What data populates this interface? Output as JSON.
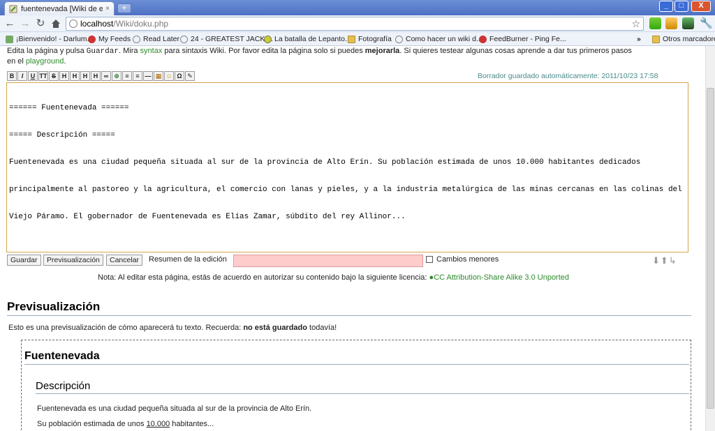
{
  "browser": {
    "tab_title": "fuentenevada [Wiki de ejempl",
    "tab_close": "×",
    "new_tab": "+",
    "win_min": "_",
    "win_max": "□",
    "win_close": "X",
    "url_host": "localhost",
    "url_path": "/Wiki/doku.php",
    "bookmark_star": "☆"
  },
  "bookmarks": {
    "items": [
      "¡Bienvenido! - Darlum...",
      "My Feeds",
      "Read Later",
      "24 - GREATEST JACK ...",
      "La batalla de Lepanto...",
      "Fotografía",
      "Como hacer un wiki d...",
      "FeedBurner - Ping Fe..."
    ],
    "overflow": "»",
    "other": "Otros marcadores"
  },
  "intro": {
    "l1a": "Edita la página y pulsa ",
    "guardar": "Guardar",
    "l1b": ". Mira ",
    "syntax": "syntax",
    "l1c": " para sintaxis Wiki. Por favor edita la página solo si puedes ",
    "mejorarla": "mejorarla",
    "l1d": ". Si quieres testear algunas cosas aprende a dar tus primeros pasos",
    "l2a": "en el ",
    "playground": "playground",
    "l2b": "."
  },
  "editbar": {
    "buttons": [
      "B",
      "I",
      "U",
      "TT",
      "S",
      "H",
      "H",
      "H",
      "H",
      "∞",
      "⊕",
      "≡",
      "≡",
      "—",
      "▦",
      "☺",
      "Ω",
      "✎"
    ]
  },
  "draft_saved": "Borrador guardado automáticamente: 2011/10/23 17:58",
  "editor": {
    "lines": [
      "====== Fuentenevada ======",
      "===== Descripción =====",
      "Fuentenevada es una ciudad pequeña situada al sur de la provincia de Alto Erín. Su población estimada de unos 10.000 habitantes dedicados",
      "principalmente al pastoreo y la agricultura, el comercio con lanas y pieles, y a la industria metalúrgica de las minas cercanas en las colinas del",
      "Viejo Páramo. El gobernador de Fuentenevada es Elías Zamar, súbdito del rey Allinor..."
    ]
  },
  "actions": {
    "save": "Guardar",
    "preview": "Previsualización",
    "cancel": "Cancelar",
    "summary_label": "Resumen de la edición",
    "summary_value": "",
    "minor_label": "Cambios menores",
    "arrows": "⬇⬆↳"
  },
  "license": {
    "text": "Nota: Al editar esta página, estás de acuerdo en autorizar su contenido bajo la siguiente licencia: ",
    "link": "CC Attribution-Share Alike 3.0 Unported"
  },
  "preview": {
    "heading": "Previsualización",
    "note_a": "Esto es una previsualización de cómo aparecerá tu texto. Recuerda: ",
    "note_b": "no está guardado",
    "note_c": " todavía!",
    "title": "Fuentenevada",
    "subtitle": "Descripción",
    "p1": "Fuentenevada es una ciudad pequeña situada al sur de la provincia de Alto Erín.",
    "p2a": "Su población estimada de unos ",
    "p2b": "10.000",
    "p2c": " habitantes..."
  },
  "colors": {
    "link_green": "#2b8a2b",
    "editor_border": "#d3a64b",
    "summary_bg": "#ffcccc",
    "titlebar": "#4d70c4"
  }
}
